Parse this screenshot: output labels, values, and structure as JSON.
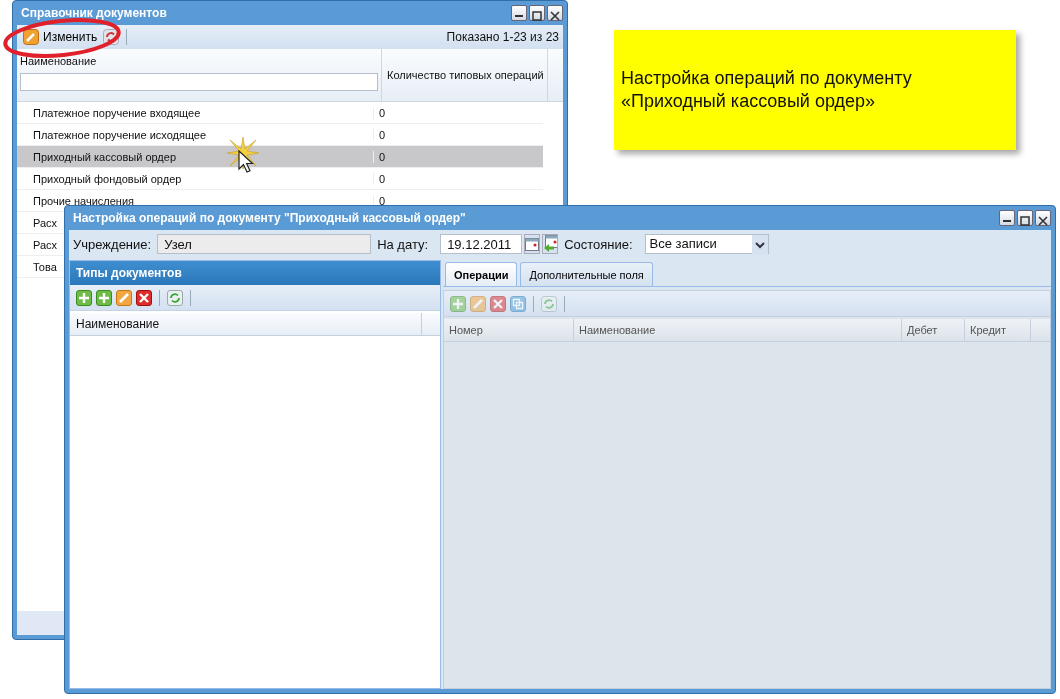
{
  "back_window": {
    "title": "Справочник документов",
    "edit_button": "Изменить",
    "paging_info": "Показано 1-23 из 23",
    "columns": [
      "Наименование",
      "Количество типовых операций"
    ],
    "rows": [
      {
        "name": "Платежное поручение входящее",
        "count": "0",
        "selected": false
      },
      {
        "name": "Платежное поручение исходящее",
        "count": "0",
        "selected": false
      },
      {
        "name": "Приходный кассовый ордер",
        "count": "0",
        "selected": true
      },
      {
        "name": "Приходный фондовый ордер",
        "count": "0",
        "selected": false
      },
      {
        "name": "Прочие начисления",
        "count": "0",
        "selected": false
      },
      {
        "name": "Расх",
        "selected": false
      },
      {
        "name": "Расх",
        "selected": false
      },
      {
        "name": "Това",
        "selected": false
      }
    ]
  },
  "callout": {
    "lines": [
      "Настройка операций по документу",
      "«Приходный кассовый ордер»"
    ]
  },
  "front_window": {
    "title": "Настройка операций по документу \"Приходный кассовый ордер\"",
    "institution": {
      "label": "Учреждение:",
      "value": "Узел",
      "disabled": true
    },
    "date": {
      "label": "На дату:",
      "value": "19.12.2011"
    },
    "state": {
      "label": "Состояние:",
      "value": "Все записи"
    },
    "left_panel": {
      "title": "Типы документов",
      "toolbar": [
        {
          "kind": "add",
          "disabled": false
        },
        {
          "kind": "add",
          "disabled": false
        },
        {
          "kind": "edit",
          "disabled": false
        },
        {
          "kind": "delete",
          "disabled": false
        },
        {
          "kind": "refresh",
          "disabled": false
        }
      ],
      "columns": [
        "Наименование"
      ]
    },
    "right_panel": {
      "tabs": [
        {
          "label": "Операции",
          "selected": true
        },
        {
          "label": "Дополнительные поля",
          "selected": false
        }
      ],
      "toolbar": [
        {
          "kind": "add",
          "disabled": true
        },
        {
          "kind": "edit",
          "disabled": true
        },
        {
          "kind": "delete",
          "disabled": true
        },
        {
          "kind": "copy",
          "disabled": true
        },
        {
          "kind": "refresh",
          "disabled": true
        }
      ],
      "columns": [
        "Номер",
        "Наименование",
        "Дебет",
        "Кредит"
      ]
    }
  }
}
